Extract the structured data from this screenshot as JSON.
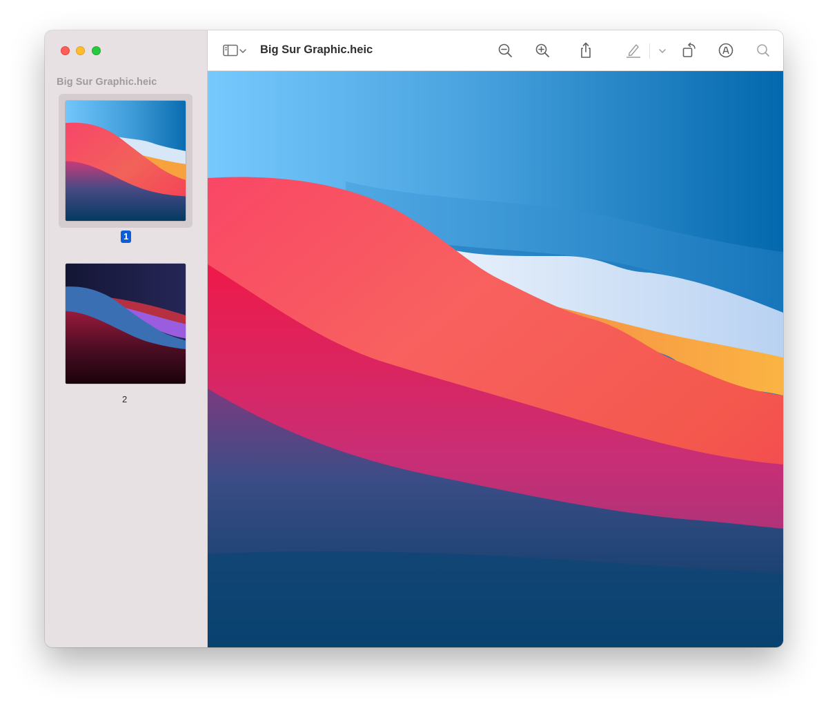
{
  "window": {
    "title": "Big Sur Graphic.heic"
  },
  "sidebar": {
    "title": "Big Sur Graphic.heic",
    "pages": [
      {
        "label": "1",
        "selected": true
      },
      {
        "label": "2",
        "selected": false
      }
    ]
  },
  "toolbar": {
    "icons": [
      "sidebar-toggle-icon",
      "chevron-down-icon",
      "zoom-out-icon",
      "zoom-in-icon",
      "share-icon",
      "highlight-pen-icon",
      "chevron-down-icon",
      "rotate-icon",
      "markup-icon",
      "search-icon"
    ]
  },
  "colors": {
    "accent": "#0b5ed7",
    "close": "#ff5f57",
    "minimize": "#febc2e",
    "maximize": "#28c840"
  }
}
